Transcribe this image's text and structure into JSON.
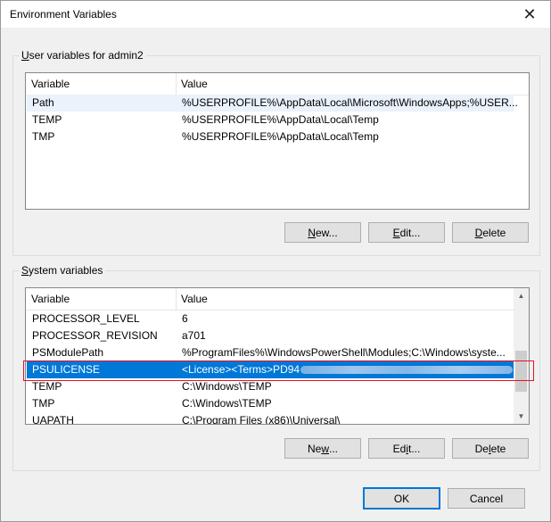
{
  "window": {
    "title": "Environment Variables",
    "close_glyph": "✕"
  },
  "user_vars": {
    "group_label_u": "U",
    "group_label_rest": "ser variables for admin2",
    "col_variable": "Variable",
    "col_value": "Value",
    "rows": [
      {
        "name": "Path",
        "value": "%USERPROFILE%\\AppData\\Local\\Microsoft\\WindowsApps;%USER..."
      },
      {
        "name": "TEMP",
        "value": "%USERPROFILE%\\AppData\\Local\\Temp"
      },
      {
        "name": "TMP",
        "value": "%USERPROFILE%\\AppData\\Local\\Temp"
      }
    ],
    "buttons": {
      "new_u": "N",
      "new_rest": "ew...",
      "edit_u": "E",
      "edit_rest": "dit...",
      "delete_u": "D",
      "delete_rest": "elete"
    }
  },
  "system_vars": {
    "group_label_u": "S",
    "group_label_rest": "ystem variables",
    "col_variable": "Variable",
    "col_value": "Value",
    "rows": [
      {
        "name": "PROCESSOR_LEVEL",
        "value": "6"
      },
      {
        "name": "PROCESSOR_REVISION",
        "value": "a701"
      },
      {
        "name": "PSModulePath",
        "value": "%ProgramFiles%\\WindowsPowerShell\\Modules;C:\\Windows\\syste..."
      },
      {
        "name": "PSULICENSE",
        "value": "<License><Terms>PD94"
      },
      {
        "name": "TEMP",
        "value": "C:\\Windows\\TEMP"
      },
      {
        "name": "TMP",
        "value": "C:\\Windows\\TEMP"
      },
      {
        "name": "UAPATH",
        "value": "C:\\Program Files (x86)\\Universal\\"
      }
    ],
    "selected_row": "PSULICENSE",
    "buttons": {
      "new_pre": "Ne",
      "new_u": "w",
      "new_rest": "...",
      "edit_pre": "Ed",
      "edit_u": "i",
      "edit_rest": "t...",
      "delete_pre": "De",
      "delete_u": "l",
      "delete_rest": "ete"
    }
  },
  "footer": {
    "ok": "OK",
    "cancel": "Cancel"
  },
  "colors": {
    "selection": "#0078d7",
    "highlight_box": "#e81123",
    "default_button_border": "#0078d7"
  },
  "icons": {
    "close": "close-icon",
    "scroll_up": "scroll-up-arrow-icon",
    "scroll_down": "scroll-down-arrow-icon"
  }
}
